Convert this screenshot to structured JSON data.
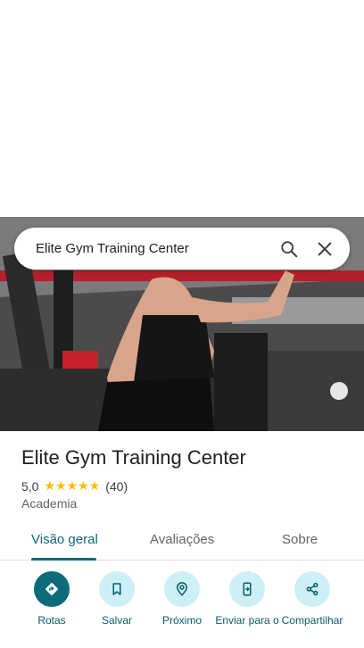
{
  "search": {
    "query": "Elite Gym Training Center"
  },
  "place": {
    "name": "Elite Gym Training Center",
    "rating": "5,0",
    "stars": "★★★★★",
    "review_count": "(40)",
    "category": "Academia"
  },
  "tabs": [
    {
      "label": "Visão geral",
      "active": true
    },
    {
      "label": "Avaliações",
      "active": false
    },
    {
      "label": "Sobre",
      "active": false
    }
  ],
  "actions": [
    {
      "label": "Rotas",
      "icon": "directions-icon"
    },
    {
      "label": "Salvar",
      "icon": "bookmark-icon"
    },
    {
      "label": "Próximo",
      "icon": "nearby-icon"
    },
    {
      "label": "Enviar para o",
      "icon": "send-to-phone-icon"
    },
    {
      "label": "Compartilhar",
      "icon": "share-icon"
    }
  ],
  "colors": {
    "accent": "#0b6b78",
    "action_bg": "#cdf0f7",
    "star": "#fbbc04"
  }
}
